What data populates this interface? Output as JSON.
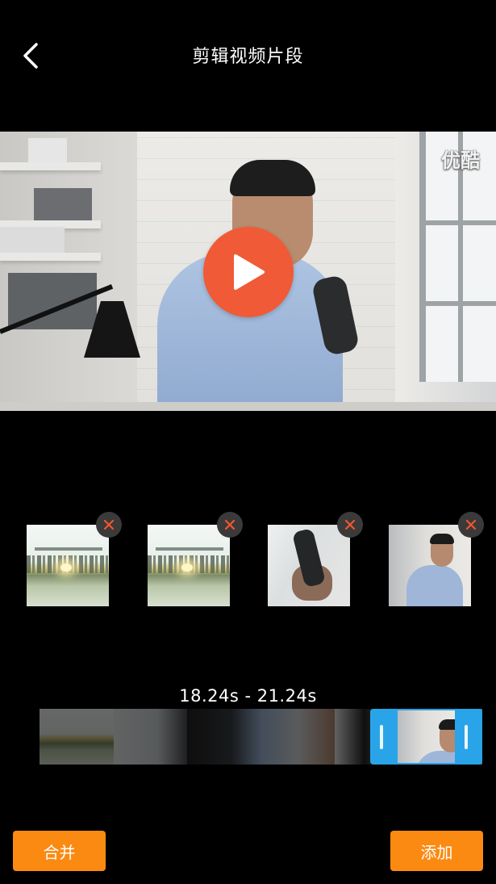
{
  "header": {
    "title": "剪辑视频片段",
    "back_icon": "chevron-left-icon"
  },
  "preview": {
    "watermark": "优酷",
    "play_icon": "play-icon",
    "play_color": "#f05a36"
  },
  "clips": [
    {
      "scene": "city-skyline",
      "remove_icon": "close-icon"
    },
    {
      "scene": "city-skyline",
      "remove_icon": "close-icon"
    },
    {
      "scene": "hand-device",
      "remove_icon": "close-icon"
    },
    {
      "scene": "man-office",
      "remove_icon": "close-icon"
    }
  ],
  "trim": {
    "range_text": "18.24s - 21.24s",
    "selection_color": "#2aa4e8"
  },
  "actions": {
    "merge_label": "合并",
    "add_label": "添加",
    "button_color": "#fb8a12"
  }
}
